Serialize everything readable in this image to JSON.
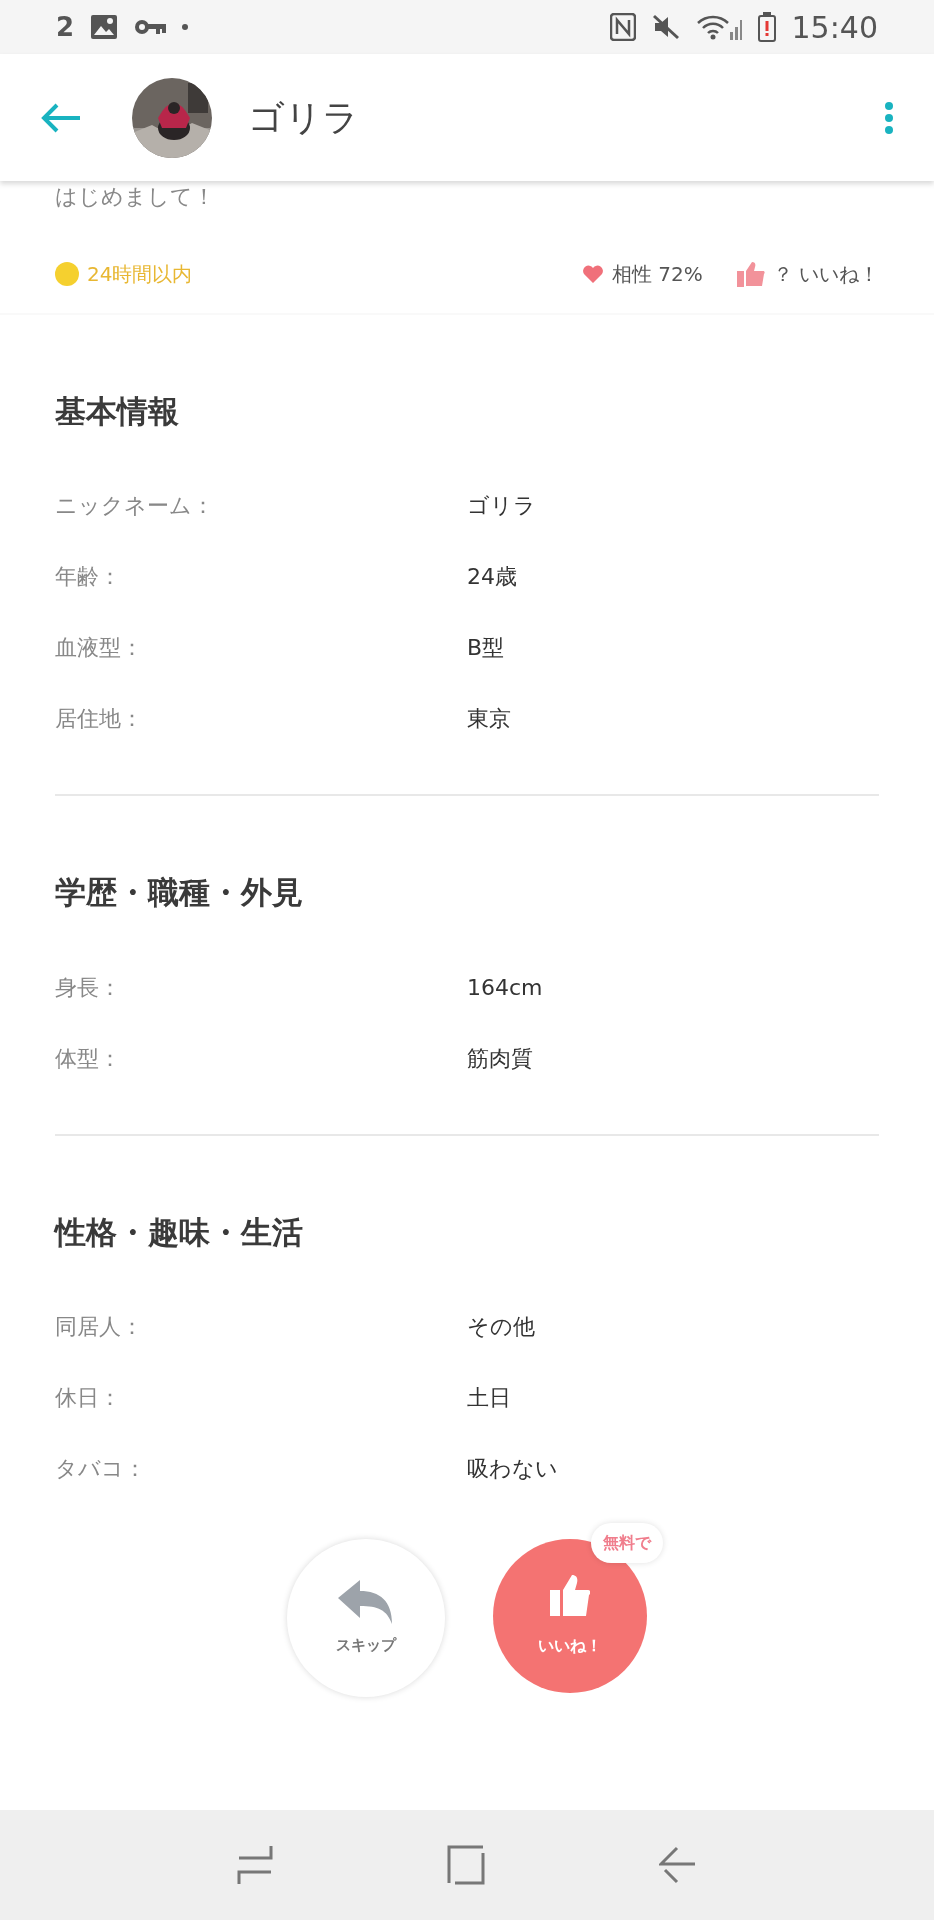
{
  "status_bar": {
    "notification_count": "2",
    "time": "15:40"
  },
  "header": {
    "title": "ゴリラ"
  },
  "greeting": "はじめまして！",
  "activity": "24時間以内",
  "compatibility": "相性 72%",
  "likes": "？ いいね！",
  "sections": [
    {
      "title": "基本情報",
      "rows": [
        {
          "label": "ニックネーム：",
          "value": "ゴリラ"
        },
        {
          "label": "年齢：",
          "value": "24歳"
        },
        {
          "label": "血液型：",
          "value": "B型"
        },
        {
          "label": "居住地：",
          "value": "東京"
        }
      ]
    },
    {
      "title": "学歴・職種・外見",
      "rows": [
        {
          "label": "身長：",
          "value": "164cm"
        },
        {
          "label": "体型：",
          "value": "筋肉質"
        }
      ]
    },
    {
      "title": "性格・趣味・生活",
      "rows": [
        {
          "label": "同居人：",
          "value": "その他"
        },
        {
          "label": "休日：",
          "value": "土日"
        },
        {
          "label": "タバコ：",
          "value": "吸わない"
        }
      ]
    }
  ],
  "actions": {
    "skip": "スキップ",
    "like": "いいね！",
    "like_badge": "無料で"
  }
}
